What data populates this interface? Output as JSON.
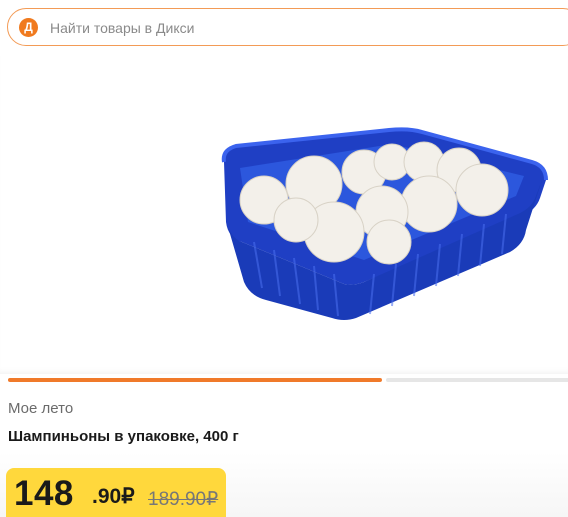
{
  "search": {
    "logo_letter": "Д",
    "placeholder": "Найти товары в Дикси"
  },
  "gallery": {
    "image_name": "mushrooms-in-blue-tray",
    "slides_total": 3,
    "active_slide": 1
  },
  "product": {
    "brand": "Мое лето",
    "title": "Шампиньоны в упаковке, 400 г"
  },
  "price": {
    "current_int": "148",
    "current_frac": ".90₽",
    "old": "189.90₽"
  },
  "colors": {
    "accent": "#f07a2a",
    "price_badge": "#ffd83c",
    "tray_blue": "#2345c9"
  }
}
